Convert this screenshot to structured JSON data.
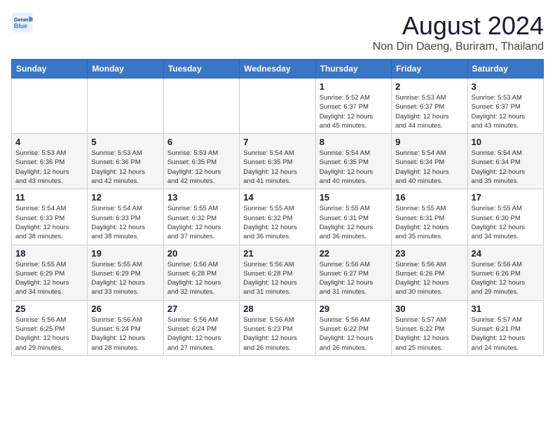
{
  "header": {
    "logo_line1": "General",
    "logo_line2": "Blue",
    "title": "August 2024",
    "subtitle": "Non Din Daeng, Buriram, Thailand"
  },
  "days_of_week": [
    "Sunday",
    "Monday",
    "Tuesday",
    "Wednesday",
    "Thursday",
    "Friday",
    "Saturday"
  ],
  "weeks": [
    [
      {
        "day": "",
        "info": ""
      },
      {
        "day": "",
        "info": ""
      },
      {
        "day": "",
        "info": ""
      },
      {
        "day": "",
        "info": ""
      },
      {
        "day": "1",
        "info": "Sunrise: 5:52 AM\nSunset: 6:37 PM\nDaylight: 12 hours\nand 45 minutes."
      },
      {
        "day": "2",
        "info": "Sunrise: 5:53 AM\nSunset: 6:37 PM\nDaylight: 12 hours\nand 44 minutes."
      },
      {
        "day": "3",
        "info": "Sunrise: 5:53 AM\nSunset: 6:37 PM\nDaylight: 12 hours\nand 43 minutes."
      }
    ],
    [
      {
        "day": "4",
        "info": "Sunrise: 5:53 AM\nSunset: 6:36 PM\nDaylight: 12 hours\nand 43 minutes."
      },
      {
        "day": "5",
        "info": "Sunrise: 5:53 AM\nSunset: 6:36 PM\nDaylight: 12 hours\nand 42 minutes."
      },
      {
        "day": "6",
        "info": "Sunrise: 5:53 AM\nSunset: 6:35 PM\nDaylight: 12 hours\nand 42 minutes."
      },
      {
        "day": "7",
        "info": "Sunrise: 5:54 AM\nSunset: 6:35 PM\nDaylight: 12 hours\nand 41 minutes."
      },
      {
        "day": "8",
        "info": "Sunrise: 5:54 AM\nSunset: 6:35 PM\nDaylight: 12 hours\nand 40 minutes."
      },
      {
        "day": "9",
        "info": "Sunrise: 5:54 AM\nSunset: 6:34 PM\nDaylight: 12 hours\nand 40 minutes."
      },
      {
        "day": "10",
        "info": "Sunrise: 5:54 AM\nSunset: 6:34 PM\nDaylight: 12 hours\nand 39 minutes."
      }
    ],
    [
      {
        "day": "11",
        "info": "Sunrise: 5:54 AM\nSunset: 6:33 PM\nDaylight: 12 hours\nand 38 minutes."
      },
      {
        "day": "12",
        "info": "Sunrise: 5:54 AM\nSunset: 6:33 PM\nDaylight: 12 hours\nand 38 minutes."
      },
      {
        "day": "13",
        "info": "Sunrise: 5:55 AM\nSunset: 6:32 PM\nDaylight: 12 hours\nand 37 minutes."
      },
      {
        "day": "14",
        "info": "Sunrise: 5:55 AM\nSunset: 6:32 PM\nDaylight: 12 hours\nand 36 minutes."
      },
      {
        "day": "15",
        "info": "Sunrise: 5:55 AM\nSunset: 6:31 PM\nDaylight: 12 hours\nand 36 minutes."
      },
      {
        "day": "16",
        "info": "Sunrise: 5:55 AM\nSunset: 6:31 PM\nDaylight: 12 hours\nand 35 minutes."
      },
      {
        "day": "17",
        "info": "Sunrise: 5:55 AM\nSunset: 6:30 PM\nDaylight: 12 hours\nand 34 minutes."
      }
    ],
    [
      {
        "day": "18",
        "info": "Sunrise: 5:55 AM\nSunset: 6:29 PM\nDaylight: 12 hours\nand 34 minutes."
      },
      {
        "day": "19",
        "info": "Sunrise: 5:55 AM\nSunset: 6:29 PM\nDaylight: 12 hours\nand 33 minutes."
      },
      {
        "day": "20",
        "info": "Sunrise: 5:56 AM\nSunset: 6:28 PM\nDaylight: 12 hours\nand 32 minutes."
      },
      {
        "day": "21",
        "info": "Sunrise: 5:56 AM\nSunset: 6:28 PM\nDaylight: 12 hours\nand 31 minutes."
      },
      {
        "day": "22",
        "info": "Sunrise: 5:56 AM\nSunset: 6:27 PM\nDaylight: 12 hours\nand 31 minutes."
      },
      {
        "day": "23",
        "info": "Sunrise: 5:56 AM\nSunset: 6:26 PM\nDaylight: 12 hours\nand 30 minutes."
      },
      {
        "day": "24",
        "info": "Sunrise: 5:56 AM\nSunset: 6:26 PM\nDaylight: 12 hours\nand 29 minutes."
      }
    ],
    [
      {
        "day": "25",
        "info": "Sunrise: 5:56 AM\nSunset: 6:25 PM\nDaylight: 12 hours\nand 29 minutes."
      },
      {
        "day": "26",
        "info": "Sunrise: 5:56 AM\nSunset: 6:24 PM\nDaylight: 12 hours\nand 28 minutes."
      },
      {
        "day": "27",
        "info": "Sunrise: 5:56 AM\nSunset: 6:24 PM\nDaylight: 12 hours\nand 27 minutes."
      },
      {
        "day": "28",
        "info": "Sunrise: 5:56 AM\nSunset: 6:23 PM\nDaylight: 12 hours\nand 26 minutes."
      },
      {
        "day": "29",
        "info": "Sunrise: 5:56 AM\nSunset: 6:22 PM\nDaylight: 12 hours\nand 26 minutes."
      },
      {
        "day": "30",
        "info": "Sunrise: 5:57 AM\nSunset: 6:22 PM\nDaylight: 12 hours\nand 25 minutes."
      },
      {
        "day": "31",
        "info": "Sunrise: 5:57 AM\nSunset: 6:21 PM\nDaylight: 12 hours\nand 24 minutes."
      }
    ]
  ]
}
